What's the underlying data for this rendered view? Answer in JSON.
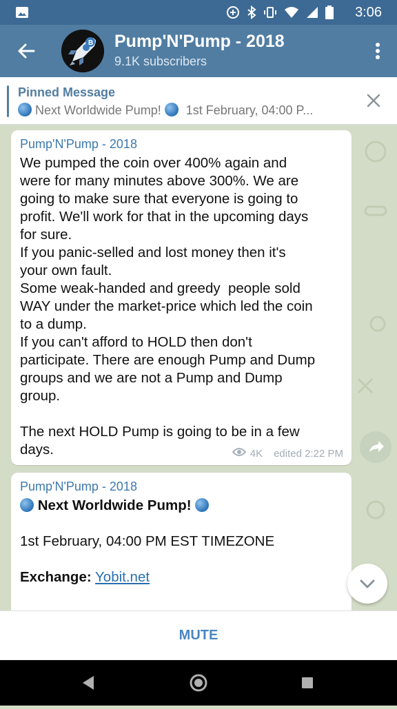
{
  "status_bar": {
    "time": "3:06"
  },
  "header": {
    "title": "Pump'N'Pump - 2018",
    "subtitle": "9.1K subscribers",
    "avatar_icon": "rocket-icon"
  },
  "pinned": {
    "label": "Pinned Message",
    "text": "Next Worldwide Pump!",
    "text2": "1st February, 04:00 P..."
  },
  "messages": [
    {
      "author": "Pump'N'Pump - 2018",
      "body": "We pumped the coin over 400% again and\nwere for many minutes above 300%. We are\ngoing to make sure that everyone is going to\nprofit. We'll work for that in the upcoming days\nfor sure.\nIf you panic-selled and lost money then it's\nyour own fault.\nSome weak-handed and greedy  people sold\nWAY under the market-price which led the coin\nto a dump.\nIf you can't afford to HOLD then don't\nparticipate. There are enough Pump and Dump\ngroups and we are not a Pump and Dump\ngroup.\n\nThe next HOLD Pump is going to be in a few\ndays.",
      "views": "4K",
      "time": "edited 2:22 PM"
    },
    {
      "author": "Pump'N'Pump - 2018",
      "headline": "Next Worldwide Pump!",
      "date_line": "1st February, 04:00 PM EST TIMEZONE",
      "exchange_label": "Exchange:",
      "exchange_link": "Yobit.net"
    }
  ],
  "mute_label": "MUTE",
  "colors": {
    "header": "#517da2",
    "statusbar": "#3d6a94",
    "accent": "#4a86c0"
  }
}
